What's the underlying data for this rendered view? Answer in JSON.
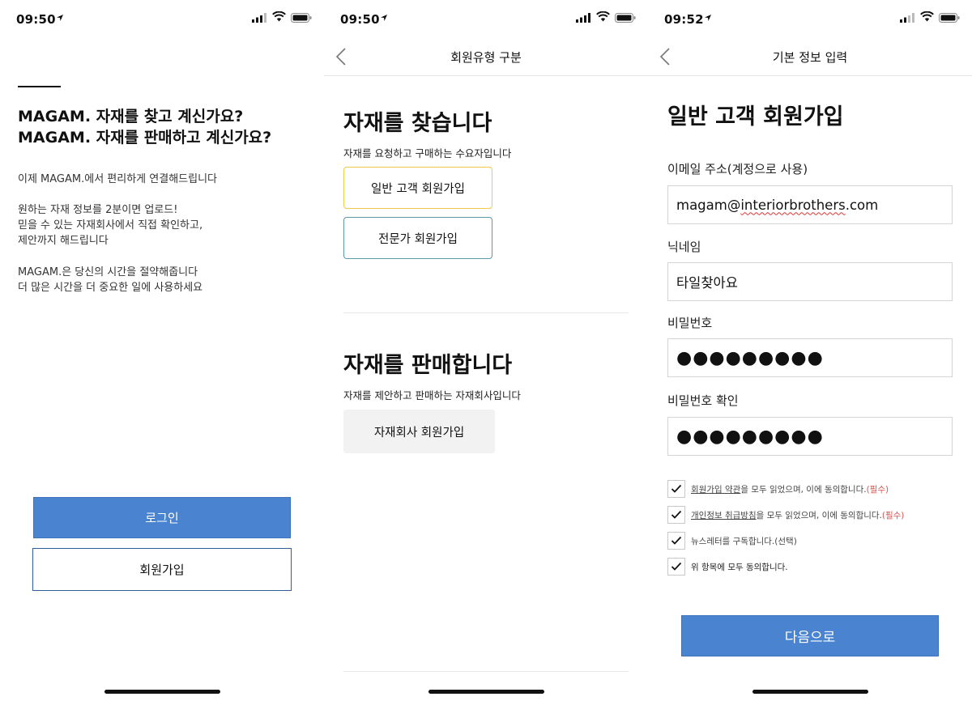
{
  "colors": {
    "primary": "#4a84d0",
    "highlight_border": "#f2c94c",
    "teal_border": "#5a9aa8",
    "required": "#d9534f"
  },
  "icons": [
    "location-arrow-icon",
    "signal-icon",
    "wifi-icon",
    "battery-icon",
    "back-chevron-icon",
    "checkmark-icon"
  ],
  "screen1": {
    "status_time": "09:50",
    "headline_1": "MAGAM. 자재를 찾고 계신가요?",
    "headline_2": "MAGAM. 자재를 판매하고 계신가요?",
    "para_1": "이제 MAGAM.에서 편리하게 연결해드립니다",
    "para_2_l1": "원하는 자재 정보를 2분이면 업로드!",
    "para_2_l2": "믿을 수 있는 자재회사에서 직접 확인하고,",
    "para_2_l3": "제안까지 해드립니다",
    "para_3_l1": "MAGAM.은 당신의 시간을 절약해줍니다",
    "para_3_l2": "더 많은 시간을 더 중요한 일에 사용하세요",
    "login_label": "로그인",
    "signup_label": "회원가입"
  },
  "screen2": {
    "status_time": "09:50",
    "nav_title": "회원유형 구분",
    "find_heading": "자재를 찾습니다",
    "find_sub": "자재를 요청하고 구매하는 수요자입니다",
    "general_signup": "일반 고객 회원가입",
    "expert_signup": "전문가 회원가입",
    "sell_heading": "자재를 판매합니다",
    "sell_sub": "자재를 제안하고 판매하는 자재회사입니다",
    "supplier_signup": "자재회사 회원가입"
  },
  "screen3": {
    "status_time": "09:52",
    "nav_title": "기본 정보 입력",
    "page_heading": "일반 고객 회원가입",
    "email_label": "이메일 주소(계정으로 사용)",
    "email_pre": "magam@",
    "email_mid": "interiorbrothers",
    "email_post": ".com",
    "nickname_label": "닉네임",
    "nickname_value": "타일찾아요",
    "password_label": "비밀번호",
    "password_value": "●●●●●●●●●",
    "password_confirm_label": "비밀번호 확인",
    "password_confirm_value": "●●●●●●●●●",
    "agree_terms_link": "회원가입 약관",
    "agree_terms_text": "을 모두 읽었으며, 이에 동의합니다.",
    "agree_terms_req": "(필수)",
    "agree_privacy_link": "개인정보 취급방침",
    "agree_privacy_text": "을 모두 읽었으며, 이에 동의합니다.",
    "agree_privacy_req": "(필수)",
    "newsletter_text": "뉴스레터를 구독합니다.(선택)",
    "agree_all_text": "위 항목에 모두 동의합니다.",
    "next_label": "다음으로"
  }
}
